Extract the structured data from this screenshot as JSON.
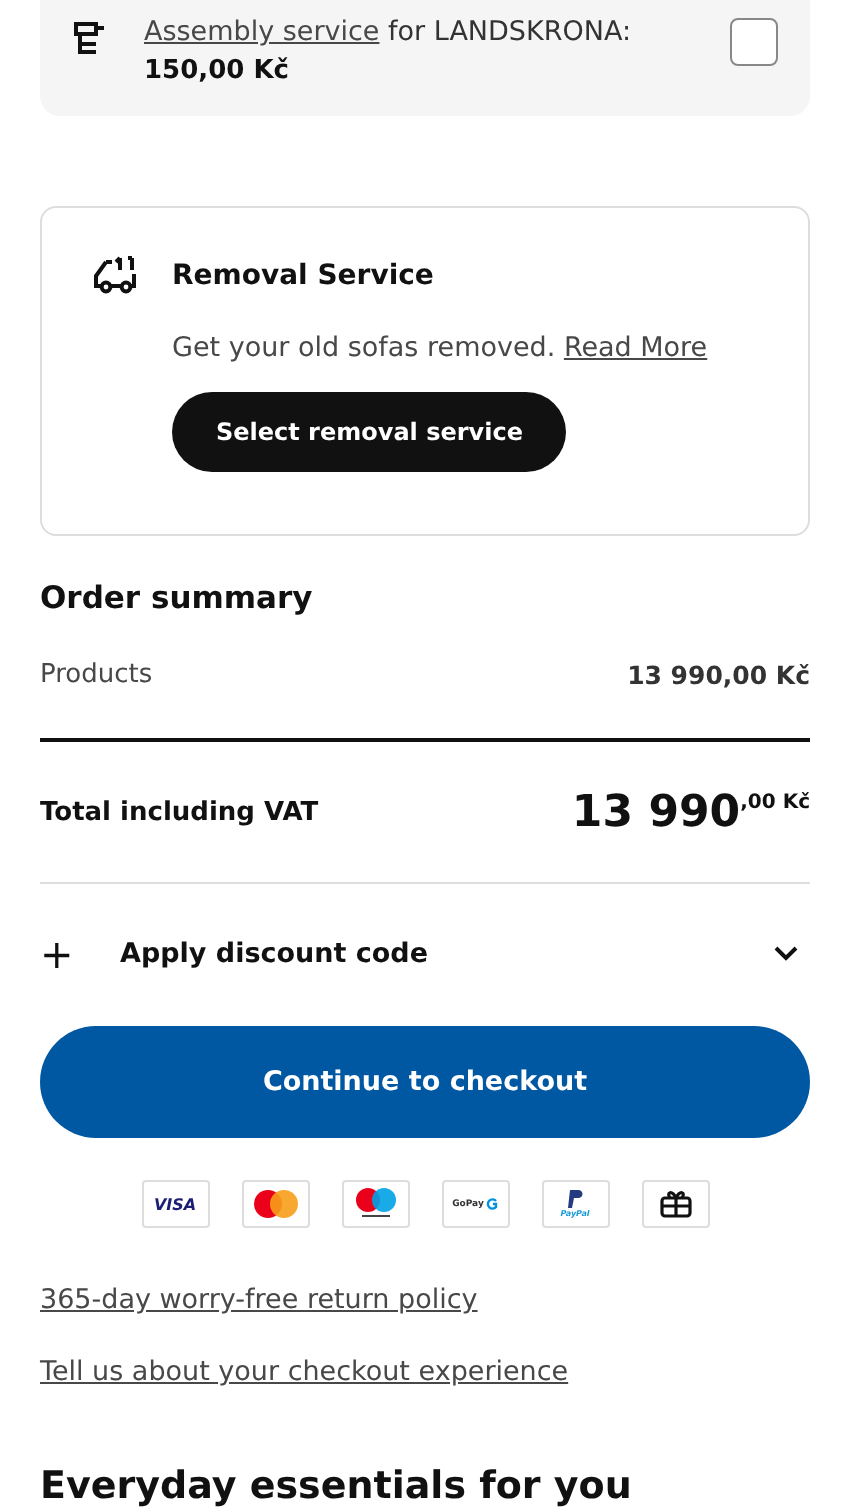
{
  "assembly": {
    "link": "Assembly service",
    "text": " for LANDSKRONA:",
    "price": "150,00 Kč",
    "checked": false
  },
  "removal": {
    "title": "Removal Service",
    "description": "Get your old sofas removed.",
    "link": "Read More",
    "button": "Select removal service"
  },
  "summary": {
    "title": "Order summary",
    "products_label": "Products",
    "products_value": "13 990,00 Kč",
    "total_label": "Total including VAT",
    "total_value": "13 990$^{,00 Kč}$"
  },
  "discount": {
    "icon": "+",
    "label": "Apply discount code",
    "expanded": false
  },
  "checkout_button": "Continue to checkout",
  "payment_methods": [
    {
      "kind": "visa",
      "label": "VISA"
    },
    {
      "kind": "mastercard"
    },
    {
      "kind": "maestro"
    },
    {
      "kind": "gopay",
      "label": "GoPay"
    },
    {
      "kind": "paypal",
      "label": "PayPal"
    },
    {
      "kind": "gift"
    }
  ],
  "links": [
    "365-day worry-free return policy",
    "Tell us about your checkout experience"
  ],
  "next_heading": "Everyday essentials for you"
}
